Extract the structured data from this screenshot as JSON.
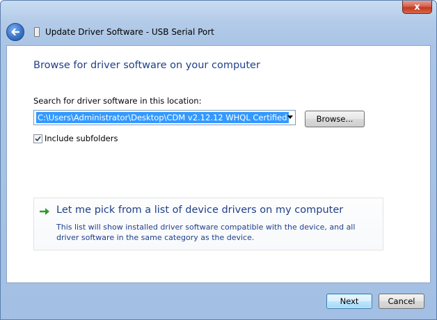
{
  "window": {
    "title": "Update Driver Software - USB Serial Port",
    "close_glyph": "x"
  },
  "main": {
    "heading": "Browse for driver software on your computer",
    "search_label": "Search for driver software in this location:",
    "path_value": "C:\\Users\\Administrator\\Desktop\\CDM v2.12.12 WHQL Certified",
    "browse_label": "Browse...",
    "include_subfolders_label": "Include subfolders",
    "include_subfolders_checked": true,
    "pick_title": "Let me pick from a list of device drivers on my computer",
    "pick_description": "This list will show installed driver software compatible with the device, and all driver software in the same category as the device."
  },
  "footer": {
    "next_label": "Next",
    "cancel_label": "Cancel"
  },
  "icons": {
    "back": "back-arrow-icon",
    "usb": "usb-device-icon",
    "pick": "green-arrow-icon",
    "check": "checkmark-icon",
    "dropdown": "chevron-down-icon"
  },
  "colors": {
    "accent": "#1e3f8a",
    "selection": "#3399ff",
    "close": "#c2391f"
  }
}
